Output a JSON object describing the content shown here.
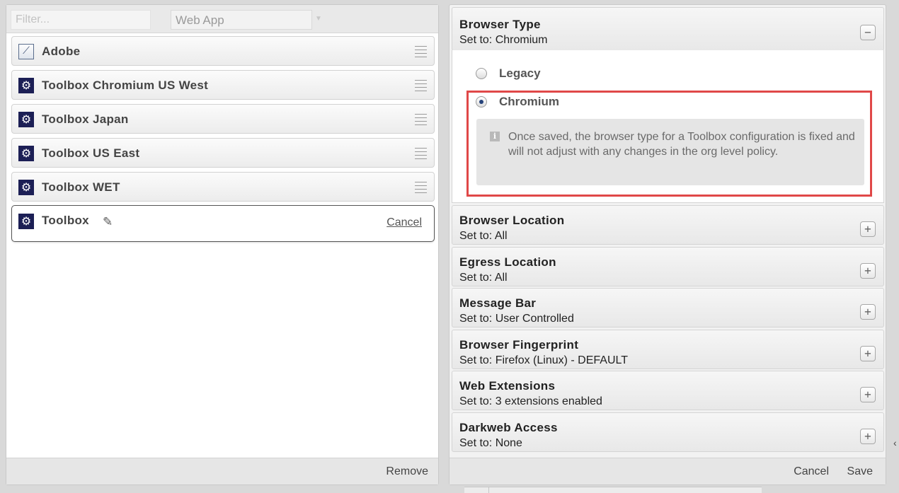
{
  "filter": {
    "placeholder": "Filter..."
  },
  "type_select": {
    "value": "Web App"
  },
  "apps": [
    {
      "label": "Adobe",
      "icon": "adobe-app-icon"
    },
    {
      "label": "Toolbox Chromium US West",
      "icon": "gear-icon"
    },
    {
      "label": "Toolbox Japan",
      "icon": "gear-icon"
    },
    {
      "label": "Toolbox US East",
      "icon": "gear-icon"
    },
    {
      "label": "Toolbox WET",
      "icon": "gear-icon"
    }
  ],
  "editing_app": {
    "label": "Toolbox",
    "icon": "gear-icon",
    "edit_icon": "pencil-icon",
    "cancel_label": "Cancel"
  },
  "left_footer": {
    "remove_label": "Remove"
  },
  "browser_type": {
    "title": "Browser Type",
    "subtitle": "Set to: Chromium",
    "toggle": "−",
    "options": [
      {
        "label": "Legacy",
        "checked": false
      },
      {
        "label": "Chromium",
        "checked": true
      }
    ],
    "info_text": "Once saved, the browser type for a Toolbox configuration is fixed and will not adjust with any changes in the org level policy."
  },
  "sections": [
    {
      "title": "Browser Location",
      "subtitle": "Set to: All",
      "toggle": "+"
    },
    {
      "title": "Egress Location",
      "subtitle": "Set to: All",
      "toggle": "+"
    },
    {
      "title": "Message Bar",
      "subtitle": "Set to: User Controlled",
      "toggle": "+"
    },
    {
      "title": "Browser Fingerprint",
      "subtitle": "Set to: Firefox (Linux) - DEFAULT",
      "toggle": "+"
    },
    {
      "title": "Web Extensions",
      "subtitle": "Set to: 3 extensions enabled",
      "toggle": "+"
    },
    {
      "title": "Darkweb Access",
      "subtitle": "Set to: None",
      "toggle": "+"
    }
  ],
  "right_footer": {
    "cancel_label": "Cancel",
    "save_label": "Save"
  },
  "colors": {
    "highlight": "#e04848",
    "icon_bg": "#1c1f55",
    "radio_dot": "#25427a"
  }
}
